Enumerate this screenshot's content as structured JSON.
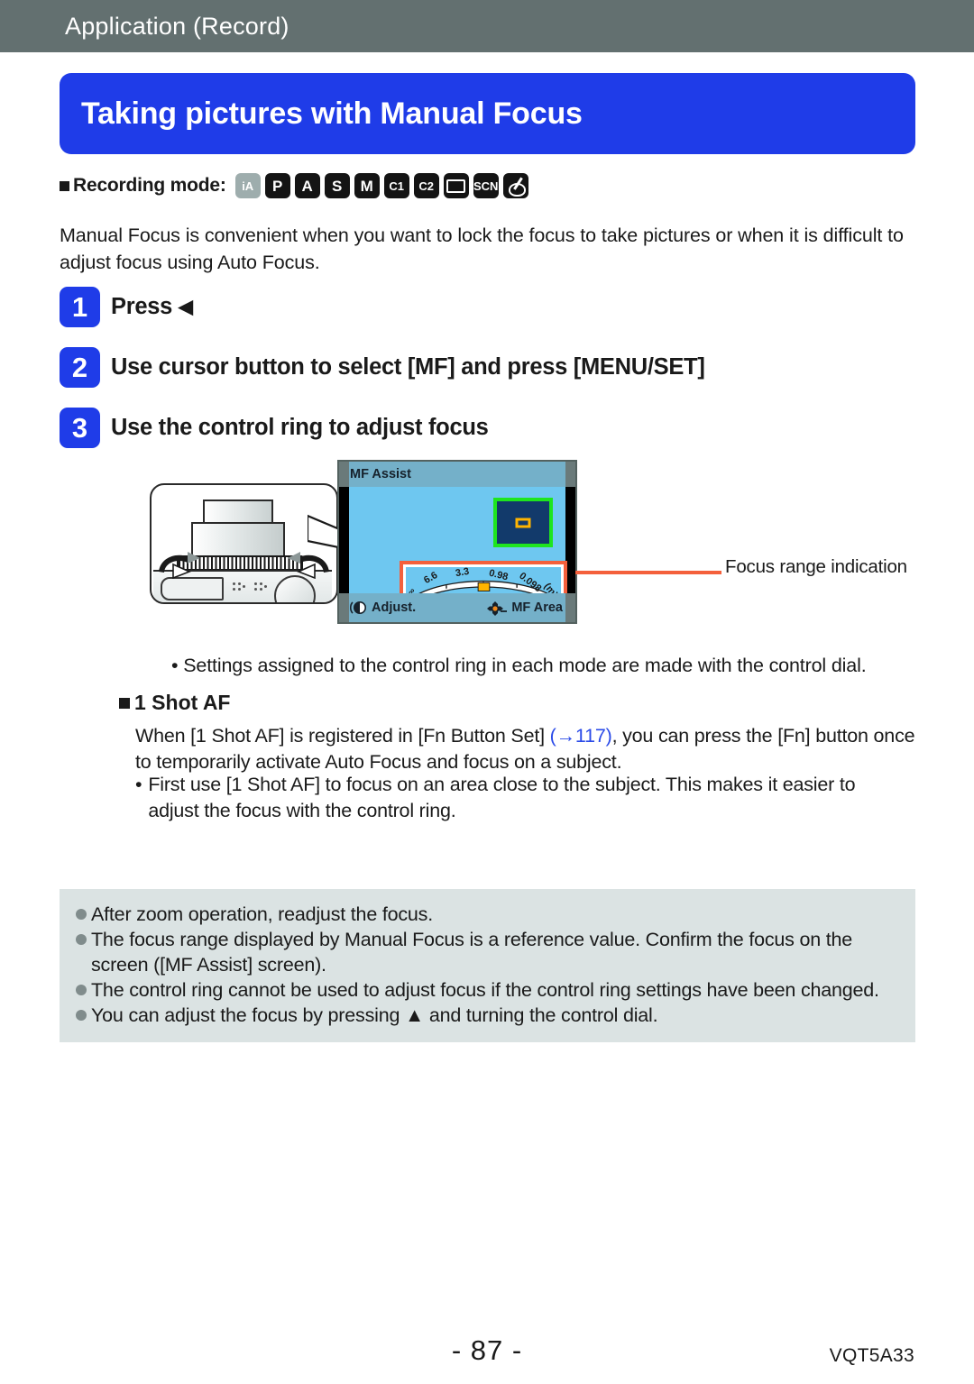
{
  "header": {
    "title": "Application (Record)"
  },
  "title_bar": {
    "text": "Taking pictures with Manual Focus"
  },
  "recording_mode": {
    "label": "Recording mode:",
    "icons": [
      {
        "name": "mode-icon-ia",
        "text": "iA",
        "style": "ia small"
      },
      {
        "name": "mode-icon-p",
        "text": "P",
        "style": ""
      },
      {
        "name": "mode-icon-a",
        "text": "A",
        "style": ""
      },
      {
        "name": "mode-icon-s",
        "text": "S",
        "style": ""
      },
      {
        "name": "mode-icon-m",
        "text": "M",
        "style": ""
      },
      {
        "name": "mode-icon-c1",
        "text": "C1",
        "style": "small"
      },
      {
        "name": "mode-icon-c2",
        "text": "C2",
        "style": "small"
      },
      {
        "name": "mode-icon-panorama",
        "text": "",
        "style": "pano"
      },
      {
        "name": "mode-icon-scn",
        "text": "SCN",
        "style": "small"
      },
      {
        "name": "mode-icon-creative-control",
        "text": "",
        "style": "creative"
      }
    ]
  },
  "intro": {
    "text": "Manual Focus is convenient when you want to lock the focus to take pictures or when it is difficult to adjust focus using Auto Focus."
  },
  "steps": [
    {
      "num": "1",
      "text": "Press ",
      "glyph": "◀"
    },
    {
      "num": "2",
      "text": "Use cursor button to select [MF] and press [MENU/SET]",
      "glyph": ""
    },
    {
      "num": "3",
      "text": "Use the control ring to adjust focus",
      "glyph": ""
    }
  ],
  "illustration": {
    "mf_screen": {
      "top_label": "MF Assist",
      "bottom_left_label": "Adjust.",
      "bottom_right_label": "MF Area",
      "focus_scale_ticks": [
        "∞",
        "6.6",
        "3.3",
        "0.98",
        "0.098",
        "(m)"
      ]
    },
    "callout_label": "Focus range indication"
  },
  "note_line": {
    "text": "• Settings assigned to the control ring in each mode are made with the control dial."
  },
  "section": {
    "heading": "1 Shot AF",
    "paragraph_part1": "When [1 Shot AF] is registered in [Fn Button Set] ",
    "paragraph_link": "(→117)",
    "paragraph_part2": ", you can press the [Fn] button once to temporarily activate Auto Focus and focus on a subject.",
    "sub_bullet_dot": "•",
    "sub_bullet": "First use [1 Shot AF] to focus on an area close to the subject. This makes it easier to adjust the focus with the control ring."
  },
  "notes": [
    "After zoom operation, readjust the focus.",
    "The focus range displayed by Manual Focus is a reference value. Confirm the focus on the screen ([MF Assist] screen).",
    "The control ring cannot be used to adjust focus if the control ring settings have been changed.",
    "You can adjust the focus by pressing ▲ and turning the control dial."
  ],
  "footer": {
    "page": "- 87 -",
    "code": "VQT5A33"
  },
  "colors": {
    "header_bg": "#637070",
    "title_blue": "#1f3ce8",
    "link_blue": "#2a4ae8",
    "notes_bg": "#dbe3e3",
    "screen_blue": "#6ec7f0",
    "screen_bar": "#74b0c9",
    "accent_orange": "#f4603c",
    "mf_area_green": "#1ee51e",
    "mf_area_navy": "#123a6b",
    "marker_orange": "#ffb400"
  }
}
